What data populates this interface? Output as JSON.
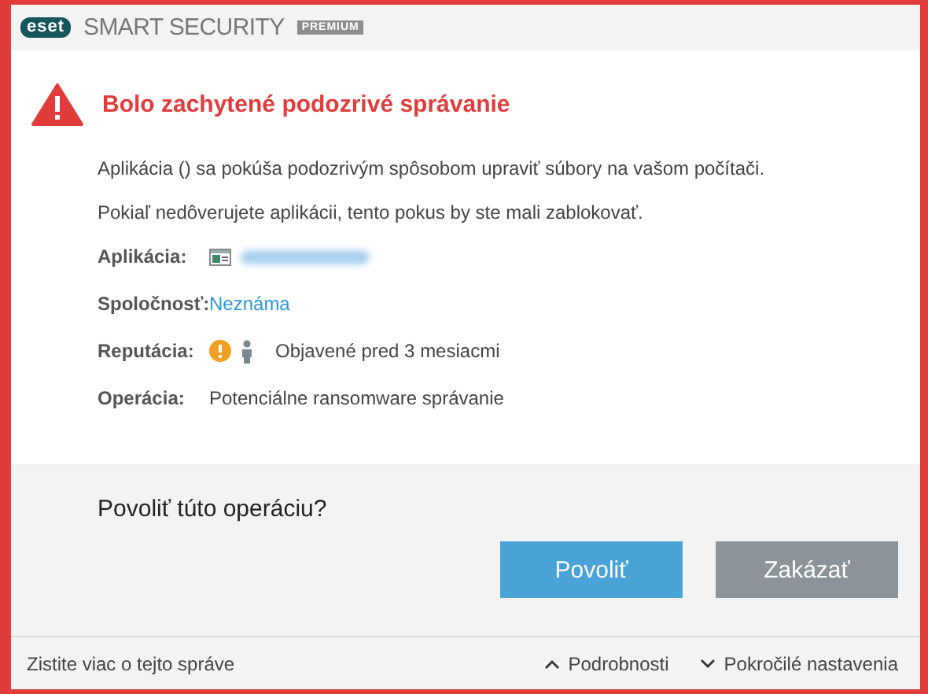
{
  "header": {
    "logo": "eset",
    "product": "SMART SECURITY",
    "edition": "PREMIUM"
  },
  "alert": {
    "title": "Bolo zachytené podozrivé správanie",
    "messages": [
      "Aplikácia () sa pokúša podozrivým spôsobom upraviť súbory na vašom počítači.",
      "Pokiaľ nedôverujete aplikácii, tento pokus by ste mali zablokovať."
    ]
  },
  "details": [
    {
      "label": "Aplikácia:",
      "kind": "app"
    },
    {
      "label": "Spoločnosť:",
      "kind": "link",
      "value": "Neznáma"
    },
    {
      "label": "Reputácia:",
      "kind": "reputation",
      "value": "Objavené pred 3 mesiacmi"
    },
    {
      "label": "Operácia:",
      "kind": "text",
      "value": "Potenciálne ransomware správanie"
    }
  ],
  "question": "Povoliť túto operáciu?",
  "buttons": [
    {
      "label": "Povoliť",
      "kind": "primary"
    },
    {
      "label": "Zakázať",
      "kind": "secondary"
    }
  ],
  "footer": {
    "link": "Zistite viac o tejto správe",
    "toggles": [
      {
        "label": "Podrobnosti",
        "expanded": true
      },
      {
        "label": "Pokročilé nastavenia",
        "expanded": false
      }
    ]
  }
}
